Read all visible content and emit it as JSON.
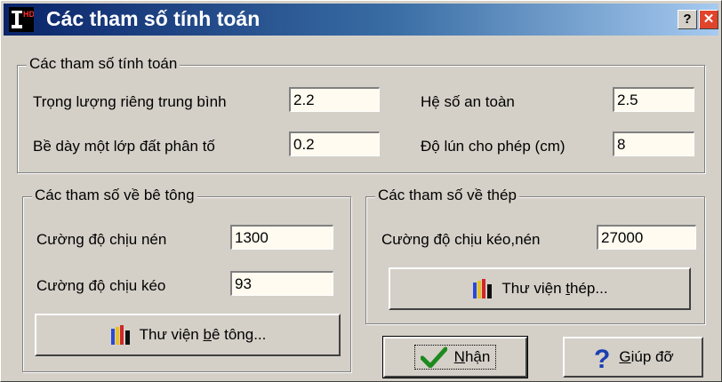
{
  "window": {
    "title": "Các tham số tính toán",
    "help_glyph": "?",
    "close_glyph": "✕",
    "app_icon": "app-logo-icon"
  },
  "general": {
    "legend": "Các tham số tính toán",
    "unit_weight_label": "Trọng lượng riêng trung bình",
    "unit_weight_value": "2.2",
    "safety_factor_label": "Hệ số an toàn",
    "safety_factor_value": "2.5",
    "layer_thickness_label": "Bề dày một lớp đất phân tố",
    "layer_thickness_value": "0.2",
    "allow_settlement_label": "Độ lún cho phép (cm)",
    "allow_settlement_value": "8"
  },
  "concrete": {
    "legend": "Các tham số về bê tông",
    "compress_label": "Cường độ chịu nén",
    "compress_value": "1300",
    "tension_label": "Cường độ chịu kéo",
    "tension_value": "93",
    "library_prefix": "Thư viện ",
    "library_underline": "b",
    "library_suffix": "ê tông..."
  },
  "steel": {
    "legend": "Các tham số về thép",
    "strength_label": "Cường độ chịu kéo,nén",
    "strength_value": "27000",
    "library_prefix": "Thư viện ",
    "library_underline": "t",
    "library_suffix": "hép..."
  },
  "buttons": {
    "ok_underline": "N",
    "ok_rest": "hận",
    "help_underline": "G",
    "help_rest": "iúp đỡ",
    "ok_icon": "checkmark-icon",
    "help_icon": "question-icon",
    "library_icon": "books-icon"
  },
  "colors": {
    "title_gradient_start": "#0a246a",
    "title_gradient_end": "#a6caf0",
    "window_face": "#d4d0c8",
    "field_bg": "#fffbf0",
    "ok_check": "#1e8a1e",
    "help_mark": "#1a3fb0"
  }
}
